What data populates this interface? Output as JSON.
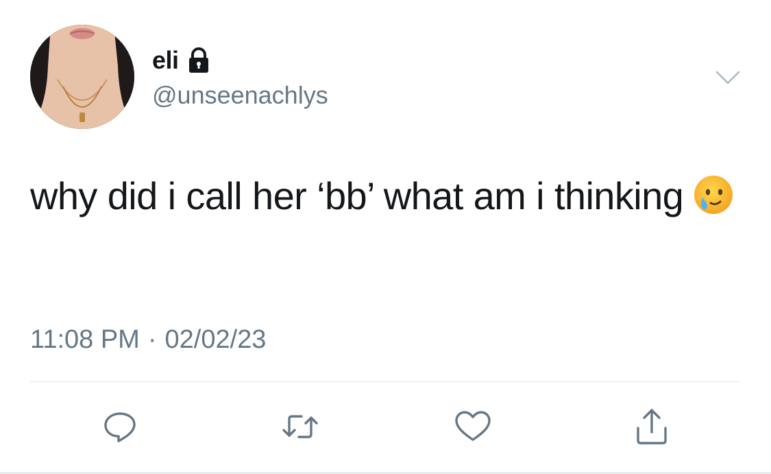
{
  "author": {
    "display_name": "eli",
    "handle": "@unseenachlys",
    "protected": true,
    "avatar": "avatar-photo",
    "lock_icon": "lock-icon"
  },
  "tweet": {
    "text": "why did i call her ‘bb’ what am i thinking",
    "emoji": "face-holding-back-tears",
    "time": "11:08 PM",
    "separator": "·",
    "date": "02/02/23"
  },
  "actions": [
    {
      "icon": "reply-icon"
    },
    {
      "icon": "retweet-icon"
    },
    {
      "icon": "like-icon"
    },
    {
      "icon": "share-icon"
    }
  ],
  "menu": {
    "icon": "chevron-down-icon"
  },
  "colors": {
    "text_primary": "#14171a",
    "text_secondary": "#657786",
    "icon_gray": "#657786",
    "divider": "#e1e8ed"
  }
}
